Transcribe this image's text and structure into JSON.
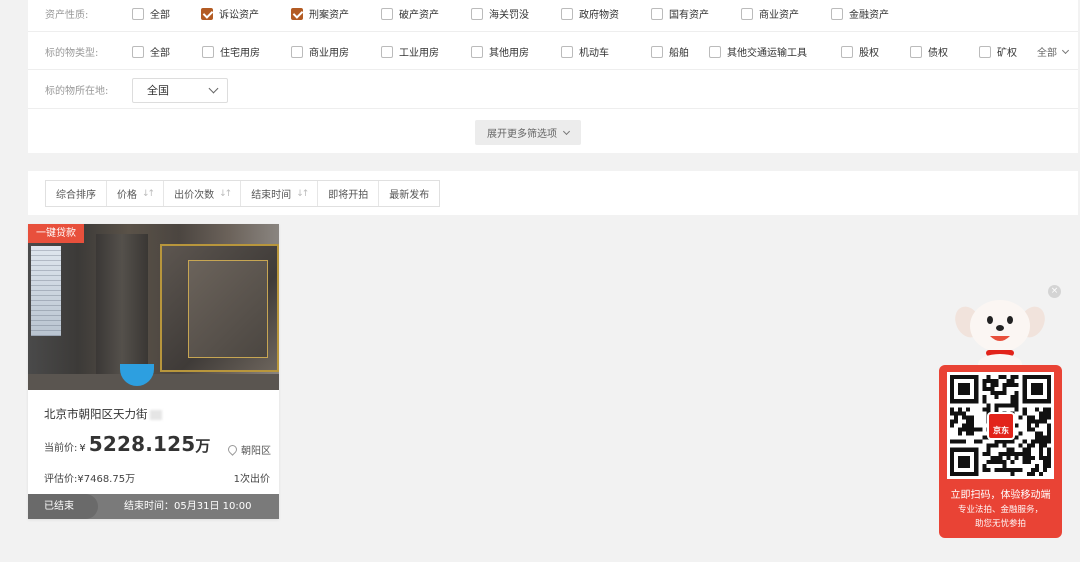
{
  "filters": {
    "asset_nature": {
      "label": "资产性质:",
      "options": [
        {
          "label": "全部",
          "checked": false
        },
        {
          "label": "诉讼资产",
          "checked": true
        },
        {
          "label": "刑案资产",
          "checked": true
        },
        {
          "label": "破产资产",
          "checked": false
        },
        {
          "label": "海关罚没",
          "checked": false
        },
        {
          "label": "政府物资",
          "checked": false
        },
        {
          "label": "国有资产",
          "checked": false
        },
        {
          "label": "商业资产",
          "checked": false
        },
        {
          "label": "金融资产",
          "checked": false
        }
      ]
    },
    "object_type": {
      "label": "标的物类型:",
      "options": [
        {
          "label": "全部",
          "checked": false
        },
        {
          "label": "住宅用房",
          "checked": false
        },
        {
          "label": "商业用房",
          "checked": false
        },
        {
          "label": "工业用房",
          "checked": false
        },
        {
          "label": "其他用房",
          "checked": false
        },
        {
          "label": "机动车",
          "checked": false
        },
        {
          "label": "船舶",
          "checked": false
        },
        {
          "label": "其他交通运输工具",
          "checked": false
        },
        {
          "label": "股权",
          "checked": false
        },
        {
          "label": "债权",
          "checked": false
        },
        {
          "label": "矿权",
          "checked": false
        }
      ],
      "expand_label": "全部"
    },
    "location": {
      "label": "标的物所在地:",
      "selected": "全国"
    },
    "more_label": "展开更多筛选项"
  },
  "sort_bar": {
    "items": [
      {
        "label": "综合排序",
        "sortable": false
      },
      {
        "label": "价格",
        "sortable": true
      },
      {
        "label": "出价次数",
        "sortable": true
      },
      {
        "label": "结束时间",
        "sortable": true
      },
      {
        "label": "即将开拍",
        "sortable": false
      },
      {
        "label": "最新发布",
        "sortable": false
      }
    ]
  },
  "listing": {
    "badge": "一键贷款",
    "title": "北京市朝阳区天力街",
    "price_label": "当前价:",
    "currency": "¥",
    "price_value": "5228.125",
    "price_unit": "万",
    "district": "朝阳区",
    "evaluation": "评估价:¥7468.75万",
    "bids": "1次出价",
    "status": "已结束",
    "end_time": "结束时间：05月31日 10:00"
  },
  "promo": {
    "logo_text": "京东",
    "line1": "立即扫码，体验移动端",
    "line2": "专业法拍、金融服务，",
    "line3": "助您无忧参拍",
    "close_symbol": "×"
  },
  "colors": {
    "accent": "#b35b23",
    "badge": "#e8503c",
    "promo": "#e94335"
  }
}
